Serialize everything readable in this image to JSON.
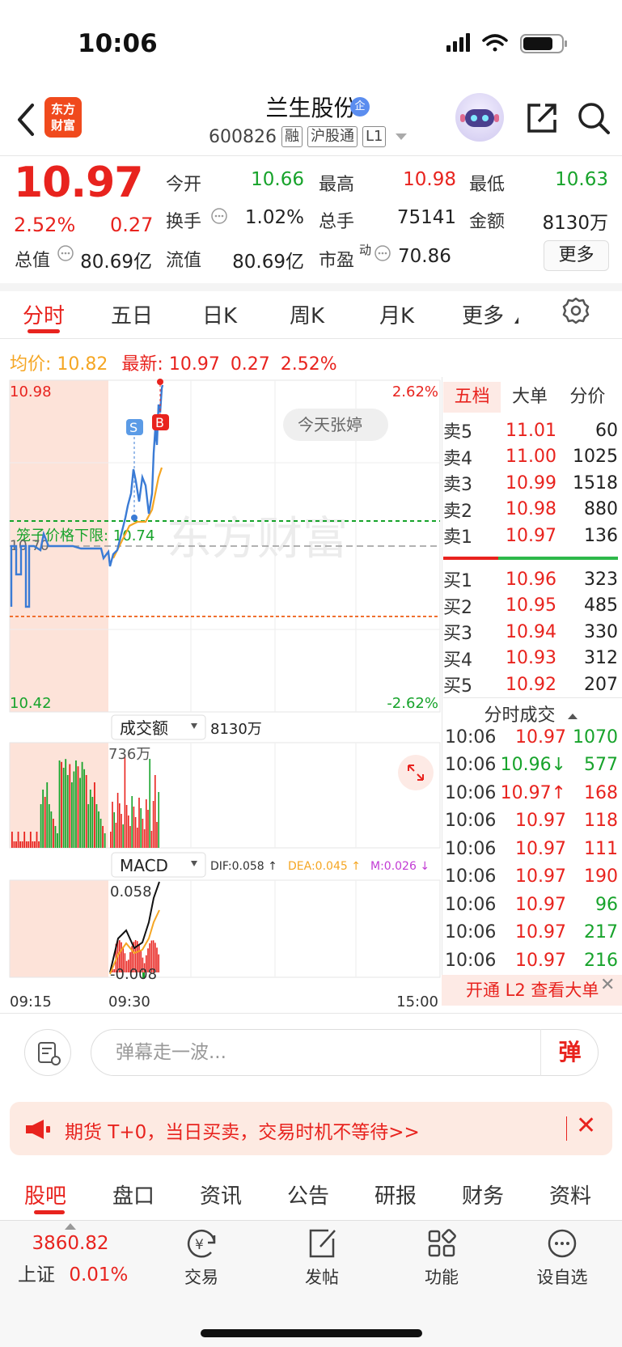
{
  "status_bar": {
    "time": "10:06"
  },
  "header": {
    "logo_line1": "东方",
    "logo_line2": "财富",
    "stock_name": "兰生股份",
    "enterprise_tag": "企",
    "code": "600826",
    "tags": [
      "融",
      "沪股通",
      "L1"
    ]
  },
  "quote": {
    "price": "10.97",
    "change_pct": "2.52%",
    "change_amt": "0.27",
    "open_label": "今开",
    "open": "10.66",
    "high_label": "最高",
    "high": "10.98",
    "low_label": "最低",
    "low": "10.63",
    "turnover_label": "换手",
    "turnover": "1.02%",
    "volume_label": "总手",
    "volume": "75141",
    "amount_label": "金额",
    "amount": "8130万",
    "mktcap_label": "总值",
    "mktcap": "80.69亿",
    "float_label": "流值",
    "float_cap": "80.69亿",
    "pe_label": "市盈",
    "pe_sup": "动",
    "pe": "70.86",
    "more": "更多"
  },
  "ktabs": [
    "分时",
    "五日",
    "日K",
    "周K",
    "月K",
    "更多"
  ],
  "avg_line": {
    "avg_label": "均价:",
    "avg": "10.82",
    "last_label": "最新:",
    "last": "10.97",
    "chg": "0.27",
    "pct": "2.52%"
  },
  "chart": {
    "y_top": "10.98",
    "y_bottom": "10.42",
    "pct_top": "2.62%",
    "pct_bottom": "-2.62%",
    "pre_close": "10.70",
    "cage_label": "笼子价格下限: 10.74",
    "note_bubble": "今天张婷",
    "marker_s": "S",
    "marker_b": "B",
    "watermark": "东方财富",
    "vol_selector": "成交额",
    "vol_total": "8130万",
    "vol_max": "736万",
    "macd_selector": "MACD",
    "dif": "DIF:0.058 ↑",
    "dea": "DEA:0.045 ↑",
    "m": "M:0.026 ↓",
    "macd_top": "0.058",
    "macd_bottom": "-0.008",
    "times": [
      "09:15",
      "09:30",
      "15:00"
    ]
  },
  "order_book": {
    "tabs": [
      "五档",
      "大单",
      "分价"
    ],
    "asks": [
      {
        "label": "卖5",
        "price": "11.01",
        "vol": "60"
      },
      {
        "label": "卖4",
        "price": "11.00",
        "vol": "1025"
      },
      {
        "label": "卖3",
        "price": "10.99",
        "vol": "1518"
      },
      {
        "label": "卖2",
        "price": "10.98",
        "vol": "880"
      },
      {
        "label": "卖1",
        "price": "10.97",
        "vol": "136"
      }
    ],
    "bids": [
      {
        "label": "买1",
        "price": "10.96",
        "vol": "323"
      },
      {
        "label": "买2",
        "price": "10.95",
        "vol": "485"
      },
      {
        "label": "买3",
        "price": "10.94",
        "vol": "330"
      },
      {
        "label": "买4",
        "price": "10.93",
        "vol": "312"
      },
      {
        "label": "买5",
        "price": "10.92",
        "vol": "207"
      }
    ]
  },
  "ticks": {
    "title": "分时成交",
    "rows": [
      {
        "time": "10:06",
        "price": "10.97",
        "vol": "1070",
        "dir": "buy"
      },
      {
        "time": "10:06",
        "price": "10.96↓",
        "vol": "577",
        "dir": "buy"
      },
      {
        "time": "10:06",
        "price": "10.97↑",
        "vol": "168",
        "dir": "sell"
      },
      {
        "time": "10:06",
        "price": "10.97",
        "vol": "118",
        "dir": "sell"
      },
      {
        "time": "10:06",
        "price": "10.97",
        "vol": "111",
        "dir": "sell"
      },
      {
        "time": "10:06",
        "price": "10.97",
        "vol": "190",
        "dir": "sell"
      },
      {
        "time": "10:06",
        "price": "10.97",
        "vol": "96",
        "dir": "buy"
      },
      {
        "time": "10:06",
        "price": "10.97",
        "vol": "217",
        "dir": "buy"
      },
      {
        "time": "10:06",
        "price": "10.97",
        "vol": "216",
        "dir": "buy"
      }
    ],
    "l2_banner": "开通 L2 查看大单",
    "l2_close": "✕"
  },
  "comment_bar": {
    "placeholder": "弹幕走一波...",
    "send": "弹"
  },
  "promo": {
    "text": "期货 T+0，当日买卖，交易时机不等待>>",
    "close": "✕"
  },
  "bottom_tabs": [
    "股吧",
    "盘口",
    "资讯",
    "公告",
    "研报",
    "财务",
    "资料"
  ],
  "nav": {
    "index_value": "3860.82",
    "index_name": "上证",
    "index_pct": "0.01%",
    "items": [
      "交易",
      "发帖",
      "功能",
      "设自选"
    ]
  },
  "colors": {
    "up": "#e8231e",
    "down": "#17a32b",
    "avg": "#f5a623",
    "price_line": "#3a7bd5"
  }
}
